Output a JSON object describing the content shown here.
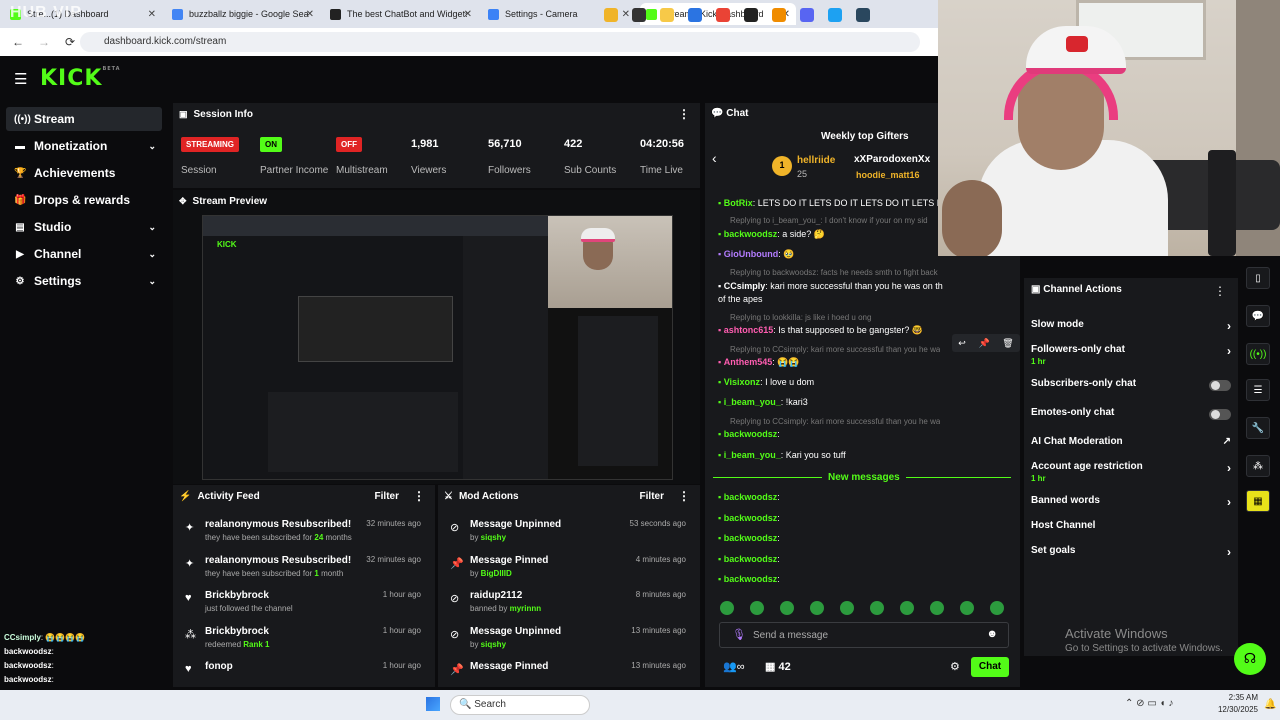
{
  "browser": {
    "tabs": [
      {
        "label": "Stre...(1) Dashboard",
        "fav": "#53fc18"
      },
      {
        "label": "buzzballz biggie - Google Sear",
        "fav": "#4285f4"
      },
      {
        "label": "The best ChatBot and Widgets",
        "fav": "#222"
      },
      {
        "label": "Settings - Camera",
        "fav": "#3b82f6"
      },
      {
        "label": "Stream - Kick Dashboard",
        "fav": "#53fc18"
      }
    ],
    "overlay_text": "HUB VIP",
    "url": "dashboard.kick.com/stream"
  },
  "kick": {
    "logo": "KICK",
    "logo_sup": "BETA"
  },
  "sidebar": {
    "items": [
      {
        "label": "Stream",
        "icon": "broadcast-icon",
        "chev": false,
        "selected": true
      },
      {
        "label": "Monetization",
        "icon": "money-icon",
        "chev": true
      },
      {
        "label": "Achievements",
        "icon": "trophy-icon",
        "chev": false
      },
      {
        "label": "Drops & rewards",
        "icon": "gift-icon",
        "chev": false
      },
      {
        "label": "Studio",
        "icon": "studio-icon",
        "chev": true
      },
      {
        "label": "Channel",
        "icon": "channel-icon",
        "chev": true
      },
      {
        "label": "Settings",
        "icon": "gear-icon",
        "chev": true
      }
    ],
    "chat_preview": [
      {
        "user": "CCsimply",
        "text": ": 😭😭😭😭"
      },
      {
        "user": "backwoodsz",
        "text": ":"
      },
      {
        "user": "backwoodsz",
        "text": ":"
      },
      {
        "user": "backwoodsz",
        "text": ":"
      },
      {
        "user": "backwoodsz",
        "text": ":"
      }
    ]
  },
  "session": {
    "title": "Session Info",
    "stats": [
      {
        "badge": "STREAMING",
        "badge_color": "#e02424",
        "label": "Session"
      },
      {
        "badge": "ON",
        "badge_color": "#53fc18",
        "label": "Partner Income"
      },
      {
        "badge": "OFF",
        "badge_color": "#e02424",
        "label": "Multistream"
      },
      {
        "value": "1,981",
        "label": "Viewers"
      },
      {
        "value": "56,710",
        "label": "Followers"
      },
      {
        "value": "422",
        "label": "Sub Counts"
      },
      {
        "value": "04:20:56",
        "label": "Time Live"
      }
    ]
  },
  "preview": {
    "title": "Stream Preview"
  },
  "activity": {
    "title": "Activity Feed",
    "filter": "Filter",
    "rows": [
      {
        "title": "realanonymous Resubscribed!",
        "sub_pre": "they have been subscribed for ",
        "sub_hl": "24",
        "sub_post": " months",
        "time": "32 minutes ago",
        "icon": "sparkle-icon"
      },
      {
        "title": "realanonymous Resubscribed!",
        "sub_pre": "they have been subscribed for ",
        "sub_hl": "1",
        "sub_post": " month",
        "time": "32 minutes ago",
        "icon": "sparkle-icon"
      },
      {
        "title": "Brickbybrock",
        "sub_pre": "just followed the channel",
        "sub_hl": "",
        "sub_post": "",
        "time": "1 hour ago",
        "icon": "heart-icon"
      },
      {
        "title": "Brickbybrock",
        "sub_pre": "redeemed ",
        "sub_hl": "Rank 1",
        "sub_post": "",
        "time": "1 hour ago",
        "icon": "reward-icon"
      },
      {
        "title": "fonop",
        "sub_pre": "",
        "sub_hl": "",
        "sub_post": "",
        "time": "1 hour ago",
        "icon": "heart-icon"
      }
    ]
  },
  "mod": {
    "title": "Mod Actions",
    "filter": "Filter",
    "rows": [
      {
        "title": "Message Unpinned",
        "sub_pre": "by ",
        "sub_hl": "siqshy",
        "time": "53 seconds ago",
        "icon": "unpin-icon"
      },
      {
        "title": "Message Pinned",
        "sub_pre": "by ",
        "sub_hl": "BigDIIID",
        "time": "4 minutes ago",
        "icon": "pin-icon"
      },
      {
        "title": "raidup2112",
        "sub_pre": "banned by ",
        "sub_hl": "myrinnn",
        "time": "8 minutes ago",
        "icon": "ban-icon"
      },
      {
        "title": "Message Unpinned",
        "sub_pre": "by ",
        "sub_hl": "siqshy",
        "time": "13 minutes ago",
        "icon": "unpin-icon"
      },
      {
        "title": "Message Pinned",
        "sub_pre": "",
        "sub_hl": "",
        "time": "13 minutes ago",
        "icon": "pin-icon"
      }
    ]
  },
  "chat": {
    "title": "Chat",
    "gifters_title": "Weekly top Gifters",
    "gifter1": "hellriide",
    "gifter1_count": "25",
    "gifter2": "xXParodoxenXx",
    "gifter3": "hoodie_matt16",
    "lines": [
      {
        "type": "msg",
        "user": "BotRix",
        "color": "#53fc18",
        "text": ": LETS DO IT LETS DO IT LETS DO IT LETS DO IT LE"
      },
      {
        "type": "reply",
        "text": "Replying to i_beam_you_: I don't know if your on my sid"
      },
      {
        "type": "msg",
        "user": "backwoodsz",
        "color": "#53fc18",
        "text": ": a side? 🤔"
      },
      {
        "type": "msg",
        "user": "GioUnbound",
        "color": "#b37cff",
        "text": ": 🥹"
      },
      {
        "type": "reply",
        "text": "Replying to backwoodsz: facts he needs smth to fight back bring up th..."
      },
      {
        "type": "msg",
        "user": "CCsimply",
        "color": "#fff",
        "text": ": kari more successful than you he was on that movie planet"
      },
      {
        "type": "cont",
        "text": "of the apes"
      },
      {
        "type": "reply",
        "text": "Replying to lookkilla: js like i hoed u ong"
      },
      {
        "type": "msg",
        "user": "ashtonc615",
        "color": "#ff5db1",
        "text": ": Is that supposed to be gangster? 🤓"
      },
      {
        "type": "reply",
        "text": "Replying to CCsimply: kari more successful than you he was"
      },
      {
        "type": "msg",
        "user": "Anthem545",
        "color": "#ff5db1",
        "text": ": 😭😭"
      },
      {
        "type": "msg",
        "user": "Visixonz",
        "color": "#53fc18",
        "text": ": I love u dom"
      },
      {
        "type": "msg",
        "user": "i_beam_you_",
        "color": "#53fc18",
        "text": ": !kari3"
      },
      {
        "type": "reply",
        "text": "Replying to CCsimply: kari more successful than you he was on that m..."
      },
      {
        "type": "msg",
        "user": "backwoodsz",
        "color": "#53fc18",
        "text": ":"
      },
      {
        "type": "msg",
        "user": "i_beam_you_",
        "color": "#53fc18",
        "text": ": Kari you so tuff"
      }
    ],
    "new_messages": "New messages",
    "after": [
      {
        "user": "backwoodsz",
        "text": ":"
      },
      {
        "user": "backwoodsz",
        "text": ":"
      },
      {
        "user": "backwoodsz",
        "text": ":"
      },
      {
        "user": "backwoodsz",
        "text": ":"
      },
      {
        "user": "backwoodsz",
        "text": ":"
      }
    ],
    "placeholder": "Send a message",
    "viewer_count": "42",
    "send_label": "Chat"
  },
  "channel_actions": {
    "title": "Channel Actions",
    "items": [
      {
        "label": "Slow mode",
        "sub": "",
        "ctrl": "chev"
      },
      {
        "label": "Followers-only chat",
        "sub": "1 hr",
        "ctrl": "chev"
      },
      {
        "label": "Subscribers-only chat",
        "sub": "",
        "ctrl": "toggle"
      },
      {
        "label": "Emotes-only chat",
        "sub": "",
        "ctrl": "toggle"
      },
      {
        "label": "AI Chat Moderation",
        "sub": "",
        "ctrl": "ext"
      },
      {
        "label": "Account age restriction",
        "sub": "1 hr",
        "ctrl": "chev"
      },
      {
        "label": "Banned words",
        "sub": "",
        "ctrl": "chev"
      },
      {
        "label": "Host Channel",
        "sub": "",
        "ctrl": "none"
      },
      {
        "label": "Set goals",
        "sub": "",
        "ctrl": "chev"
      }
    ]
  },
  "windows": {
    "activate": "Activate Windows",
    "activate_sub": "Go to Settings to activate Windows.",
    "search": "Search",
    "time": "2:35 AM",
    "date": "12/30/2025"
  }
}
